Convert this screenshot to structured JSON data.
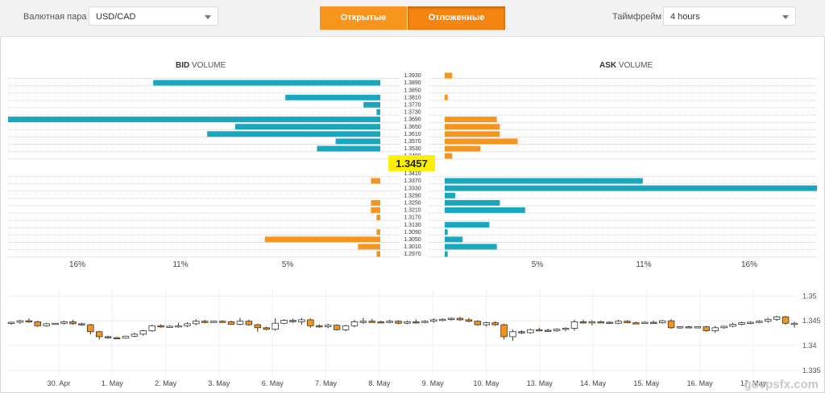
{
  "toolbar": {
    "pair_label": "Валютная пара",
    "pair_value": "USD/CAD",
    "tab_open": "Открытые",
    "tab_pending": "Отложенные",
    "timeframe_label": "Таймфрейм",
    "timeframe_value": "4 hours"
  },
  "book": {
    "bid_title_bold": "BID",
    "bid_title_rest": " VOLUME",
    "ask_title_bold": "ASK",
    "ask_title_rest": " VOLUME",
    "current_price": "1.3457",
    "bid_axis_labels": [
      "16%",
      "11%",
      "5%"
    ],
    "ask_axis_labels": [
      "5%",
      "11%",
      "16%"
    ],
    "colors": {
      "bid": "#19a6bf",
      "ask": "#f7941d",
      "highlight": "#ffef00"
    },
    "upper_levels": [
      {
        "price": "1.3930",
        "bid": 0,
        "bid_color": "bid",
        "ask": 0.5,
        "ask_color": "ask"
      },
      {
        "price": "1.3890",
        "bid": 12.2,
        "bid_color": "bid",
        "ask": 0,
        "ask_color": "ask"
      },
      {
        "price": "1.3850",
        "bid": 0,
        "bid_color": "bid",
        "ask": 0,
        "ask_color": "ask"
      },
      {
        "price": "1.3810",
        "bid": 5.1,
        "bid_color": "bid",
        "ask": 0.2,
        "ask_color": "ask"
      },
      {
        "price": "1.3770",
        "bid": 0.9,
        "bid_color": "bid",
        "ask": 0,
        "ask_color": "ask"
      },
      {
        "price": "1.3730",
        "bid": 0.2,
        "bid_color": "bid",
        "ask": 0,
        "ask_color": "ask"
      },
      {
        "price": "1.3690",
        "bid": 20.0,
        "bid_color": "bid",
        "ask": 3.5,
        "ask_color": "ask"
      },
      {
        "price": "1.3650",
        "bid": 7.8,
        "bid_color": "bid",
        "ask": 3.7,
        "ask_color": "ask"
      },
      {
        "price": "1.3610",
        "bid": 9.3,
        "bid_color": "bid",
        "ask": 3.7,
        "ask_color": "ask"
      },
      {
        "price": "1.3570",
        "bid": 2.4,
        "bid_color": "bid",
        "ask": 4.9,
        "ask_color": "ask"
      },
      {
        "price": "1.3530",
        "bid": 3.4,
        "bid_color": "bid",
        "ask": 2.4,
        "ask_color": "ask"
      },
      {
        "price": "1.3490",
        "bid": 0,
        "bid_color": "bid",
        "ask": 0.5,
        "ask_color": "ask"
      }
    ],
    "lower_levels": [
      {
        "price": "1.3410",
        "bid": 0,
        "bid_color": "ask",
        "ask": 0,
        "ask_color": "bid"
      },
      {
        "price": "1.3370",
        "bid": 0.5,
        "bid_color": "ask",
        "ask": 13.3,
        "ask_color": "bid"
      },
      {
        "price": "1.3330",
        "bid": 0,
        "bid_color": "ask",
        "ask": 25.0,
        "ask_color": "bid"
      },
      {
        "price": "1.3290",
        "bid": 0,
        "bid_color": "ask",
        "ask": 0.7,
        "ask_color": "bid"
      },
      {
        "price": "1.3250",
        "bid": 0.5,
        "bid_color": "ask",
        "ask": 3.7,
        "ask_color": "bid"
      },
      {
        "price": "1.3210",
        "bid": 0.5,
        "bid_color": "ask",
        "ask": 5.4,
        "ask_color": "bid"
      },
      {
        "price": "1.3170",
        "bid": 0.2,
        "bid_color": "ask",
        "ask": 0,
        "ask_color": "bid"
      },
      {
        "price": "1.3130",
        "bid": 0,
        "bid_color": "ask",
        "ask": 3.0,
        "ask_color": "bid"
      },
      {
        "price": "1.3090",
        "bid": 0.2,
        "bid_color": "ask",
        "ask": 0.2,
        "ask_color": "bid"
      },
      {
        "price": "1.3050",
        "bid": 6.2,
        "bid_color": "ask",
        "ask": 1.2,
        "ask_color": "bid"
      },
      {
        "price": "1.3010",
        "bid": 1.2,
        "bid_color": "ask",
        "ask": 3.5,
        "ask_color": "bid"
      },
      {
        "price": "1.2970",
        "bid": 0.2,
        "bid_color": "ask",
        "ask": 0.2,
        "ask_color": "bid"
      }
    ]
  },
  "candles": {
    "y_labels": [
      "1.35",
      "1.345",
      "1.34",
      "1.335"
    ],
    "y_values": [
      1.35,
      1.345,
      1.34,
      1.335
    ],
    "ylim": [
      1.3345,
      1.3515
    ],
    "x_labels": [
      "30. Apr",
      "1. May",
      "2. May",
      "3. May",
      "6. May",
      "7. May",
      "8. May",
      "9. May",
      "10. May",
      "13. May",
      "14. May",
      "15. May",
      "16. May",
      "17. May"
    ],
    "bull_color": "#ffffff",
    "bear_color": "#f7941d",
    "data": [
      [
        1.3445,
        1.3448,
        1.3442,
        1.3447
      ],
      [
        1.3447,
        1.3452,
        1.3444,
        1.345
      ],
      [
        1.345,
        1.3455,
        1.3446,
        1.3448
      ],
      [
        1.3448,
        1.345,
        1.3438,
        1.344
      ],
      [
        1.344,
        1.3446,
        1.3438,
        1.3444
      ],
      [
        1.3444,
        1.3446,
        1.3443,
        1.3445
      ],
      [
        1.3445,
        1.345,
        1.3442,
        1.3448
      ],
      [
        1.3448,
        1.3452,
        1.3442,
        1.3444
      ],
      [
        1.3444,
        1.3446,
        1.344,
        1.3442
      ],
      [
        1.3442,
        1.3444,
        1.3422,
        1.3428
      ],
      [
        1.3428,
        1.343,
        1.3412,
        1.3418
      ],
      [
        1.3418,
        1.342,
        1.3414,
        1.3416
      ],
      [
        1.3416,
        1.3418,
        1.3414,
        1.3415
      ],
      [
        1.3415,
        1.342,
        1.3414,
        1.3419
      ],
      [
        1.3419,
        1.3426,
        1.3417,
        1.3423
      ],
      [
        1.3423,
        1.3432,
        1.342,
        1.343
      ],
      [
        1.343,
        1.3442,
        1.3428,
        1.344
      ],
      [
        1.344,
        1.3443,
        1.3436,
        1.3438
      ],
      [
        1.3438,
        1.3441,
        1.3437,
        1.3439
      ],
      [
        1.3439,
        1.3446,
        1.3436,
        1.344
      ],
      [
        1.344,
        1.3447,
        1.3437,
        1.3444
      ],
      [
        1.3444,
        1.3453,
        1.3441,
        1.3449
      ],
      [
        1.3449,
        1.3452,
        1.3445,
        1.3447
      ],
      [
        1.3447,
        1.345,
        1.3446,
        1.3449
      ],
      [
        1.3449,
        1.3451,
        1.3446,
        1.3448
      ],
      [
        1.3448,
        1.345,
        1.3442,
        1.3443
      ],
      [
        1.3443,
        1.3456,
        1.3441,
        1.3449
      ],
      [
        1.3449,
        1.3452,
        1.344,
        1.3442
      ],
      [
        1.3442,
        1.3444,
        1.3428,
        1.3436
      ],
      [
        1.3436,
        1.3438,
        1.3431,
        1.3433
      ],
      [
        1.3433,
        1.3455,
        1.343,
        1.3445
      ],
      [
        1.3445,
        1.3453,
        1.3443,
        1.3451
      ],
      [
        1.3451,
        1.3454,
        1.3446,
        1.3448
      ],
      [
        1.3448,
        1.3456,
        1.3442,
        1.3452
      ],
      [
        1.3452,
        1.3455,
        1.3436,
        1.344
      ],
      [
        1.344,
        1.3443,
        1.3436,
        1.3438
      ],
      [
        1.3438,
        1.3444,
        1.3435,
        1.3441
      ],
      [
        1.3441,
        1.3443,
        1.343,
        1.3432
      ],
      [
        1.3432,
        1.3442,
        1.3429,
        1.344
      ],
      [
        1.344,
        1.3452,
        1.3437,
        1.3448
      ],
      [
        1.3448,
        1.3456,
        1.3444,
        1.3449
      ],
      [
        1.3449,
        1.3454,
        1.3446,
        1.3448
      ],
      [
        1.3448,
        1.345,
        1.3446,
        1.3447
      ],
      [
        1.3447,
        1.3452,
        1.3445,
        1.3449
      ],
      [
        1.3449,
        1.3451,
        1.3443,
        1.3445
      ],
      [
        1.3445,
        1.345,
        1.3443,
        1.3448
      ],
      [
        1.3448,
        1.3453,
        1.3444,
        1.3447
      ],
      [
        1.3447,
        1.3451,
        1.3445,
        1.3449
      ],
      [
        1.3449,
        1.3455,
        1.3446,
        1.3452
      ],
      [
        1.3452,
        1.3455,
        1.3449,
        1.3453
      ],
      [
        1.3453,
        1.3457,
        1.345,
        1.3455
      ],
      [
        1.3455,
        1.3458,
        1.345,
        1.3452
      ],
      [
        1.3452,
        1.3456,
        1.3447,
        1.3449
      ],
      [
        1.3449,
        1.3451,
        1.344,
        1.3442
      ],
      [
        1.3442,
        1.3448,
        1.3438,
        1.3446
      ],
      [
        1.3446,
        1.3449,
        1.344,
        1.3442
      ],
      [
        1.3442,
        1.3444,
        1.3412,
        1.3418
      ],
      [
        1.3418,
        1.3432,
        1.341,
        1.3428
      ],
      [
        1.3428,
        1.3431,
        1.3423,
        1.3426
      ],
      [
        1.3426,
        1.3434,
        1.3424,
        1.3432
      ],
      [
        1.3432,
        1.3436,
        1.3429,
        1.3431
      ],
      [
        1.3431,
        1.3434,
        1.3428,
        1.343
      ],
      [
        1.343,
        1.3435,
        1.3428,
        1.3433
      ],
      [
        1.3433,
        1.3437,
        1.3429,
        1.3435
      ],
      [
        1.3435,
        1.3452,
        1.343,
        1.3448
      ],
      [
        1.3448,
        1.3452,
        1.3444,
        1.3446
      ],
      [
        1.3446,
        1.3451,
        1.3441,
        1.3448
      ],
      [
        1.3448,
        1.345,
        1.3445,
        1.3447
      ],
      [
        1.3447,
        1.3449,
        1.3444,
        1.3445
      ],
      [
        1.3445,
        1.3452,
        1.3443,
        1.3449
      ],
      [
        1.3449,
        1.3451,
        1.3445,
        1.3446
      ],
      [
        1.3446,
        1.3448,
        1.3443,
        1.3445
      ],
      [
        1.3445,
        1.3449,
        1.3444,
        1.3447
      ],
      [
        1.3447,
        1.345,
        1.3445,
        1.3446
      ],
      [
        1.3446,
        1.3452,
        1.3444,
        1.345
      ],
      [
        1.345,
        1.3453,
        1.3434,
        1.3436
      ],
      [
        1.3436,
        1.3439,
        1.3434,
        1.3438
      ],
      [
        1.3438,
        1.344,
        1.3436,
        1.3437
      ],
      [
        1.3437,
        1.3439,
        1.3435,
        1.3438
      ],
      [
        1.3438,
        1.344,
        1.3428,
        1.343
      ],
      [
        1.343,
        1.344,
        1.3426,
        1.3436
      ],
      [
        1.3436,
        1.344,
        1.3434,
        1.3439
      ],
      [
        1.3439,
        1.3446,
        1.3437,
        1.3443
      ],
      [
        1.3443,
        1.3448,
        1.3441,
        1.3446
      ],
      [
        1.3446,
        1.3449,
        1.3443,
        1.3447
      ],
      [
        1.3447,
        1.3451,
        1.3445,
        1.3449
      ],
      [
        1.3449,
        1.3456,
        1.3446,
        1.3453
      ],
      [
        1.3453,
        1.346,
        1.345,
        1.3458
      ],
      [
        1.3458,
        1.346,
        1.3442,
        1.3445
      ],
      [
        1.3445,
        1.3448,
        1.3436,
        1.3445
      ]
    ]
  },
  "watermark": "govpsfx.com"
}
